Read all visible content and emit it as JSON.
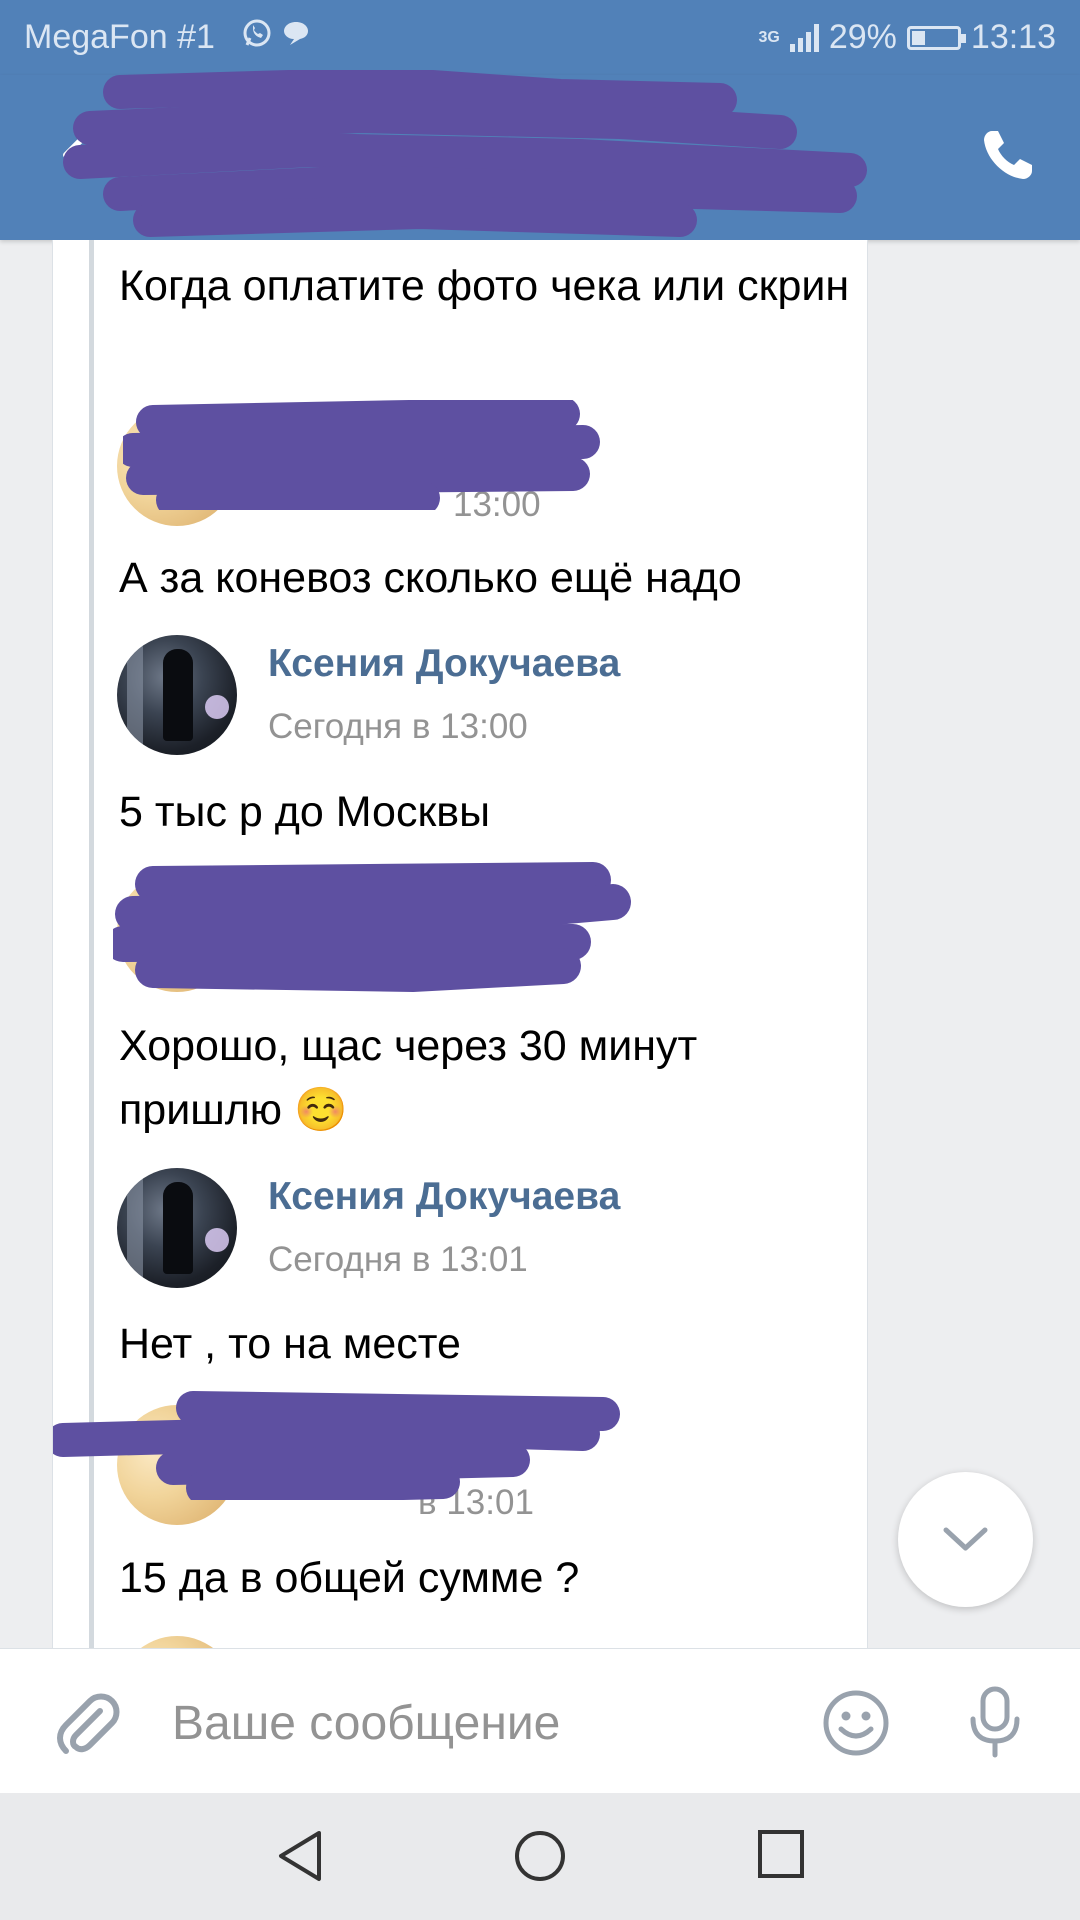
{
  "status_bar": {
    "carrier": "MegaFon #1",
    "network": "3G",
    "battery": "29%",
    "battery_level": 0.29,
    "time": "13:13"
  },
  "header": {
    "back_icon": "arrow-left-icon",
    "call_icon": "phone-icon",
    "title": "",
    "subtitle": ""
  },
  "messages": [
    {
      "text": "Когда оплатите фото чека или скрин"
    },
    {
      "sender": "",
      "time": "13:00",
      "text": "А за коневоз сколько ещё надо"
    },
    {
      "sender": "Ксения Докучаева",
      "time": "Сегодня в 13:00",
      "text": "5 тыс р до Москвы"
    },
    {
      "sender": "",
      "time": "",
      "text": "Хорошо, щас через 30 минут пришлю ☺️"
    },
    {
      "sender": "Ксения Докучаева",
      "time": "Сегодня в 13:01",
      "text": "Нет ,  то на месте"
    },
    {
      "sender": "",
      "time": "в 13:01",
      "text": "15 да в общей сумме ?"
    }
  ],
  "composer": {
    "placeholder": "Ваше сообщение",
    "attach_icon": "paperclip-icon",
    "emoji_icon": "smiley-icon",
    "mic_icon": "microphone-icon"
  },
  "scroll_button_icon": "chevron-down-icon",
  "navbar": [
    "back-triangle-icon",
    "home-circle-icon",
    "recents-square-icon"
  ],
  "colors": {
    "header_bg": "#5181b8",
    "name": "#4b6d93",
    "scribble": "#5e50a1"
  }
}
